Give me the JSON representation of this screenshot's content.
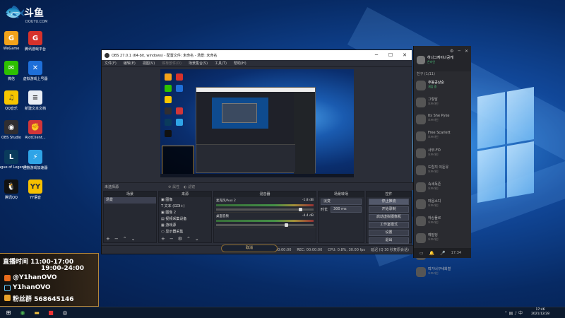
{
  "brand": {
    "title": "斗鱼",
    "subtitle": "DOUYU.COM",
    "room": "2"
  },
  "desktop_icons": [
    {
      "label": "WeGame",
      "icon": "wegame-icon",
      "color": "#f2a21a",
      "glyph": "G"
    },
    {
      "label": "腾讯游戏平台",
      "icon": "tencent-game-icon",
      "color": "#d7322b",
      "glyph": "G"
    },
    {
      "label": "微信",
      "icon": "wechat-icon",
      "color": "#2dc100",
      "glyph": "✉"
    },
    {
      "label": "虚拟游戏上号器",
      "icon": "account-tool-icon",
      "color": "#1e6fd9",
      "glyph": "✕"
    },
    {
      "label": "QQ音乐",
      "icon": "qq-music-icon",
      "color": "#f7c600",
      "glyph": "♫"
    },
    {
      "label": "新建文本文档",
      "icon": "text-doc-icon",
      "color": "#e9eef5",
      "glyph": "≡"
    },
    {
      "label": "OBS Studio",
      "icon": "obs-icon",
      "color": "#302e31",
      "glyph": "◉"
    },
    {
      "label": "RiotClient...",
      "icon": "riot-icon",
      "color": "#d13639",
      "glyph": "✊"
    },
    {
      "label": "League of Legends",
      "icon": "lol-icon",
      "color": "#0a3b5c",
      "glyph": "L"
    },
    {
      "label": "迅游游戏加速器",
      "icon": "accelerator-icon",
      "color": "#2fa4e7",
      "glyph": "⚡"
    },
    {
      "label": "腾讯QQ",
      "icon": "qq-icon",
      "color": "#111111",
      "glyph": "🐧"
    },
    {
      "label": "YY语音",
      "icon": "yy-icon",
      "color": "#f6c000",
      "glyph": "YY"
    }
  ],
  "obs": {
    "title": "OBS 27.0.1 (64-bit, windows) - 配置文件: 未命名 - 场景: 未命名",
    "menu": [
      "文件(F)",
      "编辑(E)",
      "视图(V)",
      "停靠部件(D)",
      "场景集合(S)",
      "工具(T)",
      "帮助(H)"
    ],
    "no_source": "未选择源",
    "props_label": "属性",
    "filter_label": "滤镜",
    "docks": {
      "scenes": "场景",
      "sources": "来源",
      "mixer": "混音器",
      "transitions": "场景转场",
      "controls": "控件"
    },
    "scenes": [
      "场景"
    ],
    "sources": [
      "图像",
      "文本 (GDI+)",
      "图像 2",
      "视频采集设备",
      "游戏源",
      "显示器采集"
    ],
    "mixer": [
      {
        "name": "麦克风/Aux 2",
        "db": "-1.8 dB",
        "level": 0.85
      },
      {
        "name": "桌面音频",
        "db": "-4.4 dB",
        "level": 0.7
      }
    ],
    "transition": {
      "type": "淡变",
      "duration_label": "时长",
      "duration": "300 ms"
    },
    "controls": [
      "停止推流",
      "开始录制",
      "启动虚拟摄像机",
      "工作室模式",
      "设置",
      "退出"
    ],
    "status": {
      "live_time": "LIVE: 00:00:00",
      "rec_time": "REC: 00:00:00",
      "cpu": "CPU: 0.8%, 30.00 fps",
      "drops": "延迟 (Q 30 秒复原会话)"
    },
    "bottom_button": "取消"
  },
  "kakao": {
    "title": "하나그케이너공케",
    "subtitle": "온라인",
    "section": "친구 (1/11)",
    "items": [
      {
        "name": "주동공상순",
        "status": "게임 중"
      },
      {
        "name": "그렇담",
        "status": "오프라인"
      },
      {
        "name": "Its She Pyke",
        "status": "오프라인"
      },
      {
        "name": "Free Scarlett",
        "status": "오프라인"
      },
      {
        "name": "사부-FO",
        "status": "오프라인"
      },
      {
        "name": "드립지 이둔유",
        "status": "오프라인"
      },
      {
        "name": "속세독존",
        "status": "오프라인"
      },
      {
        "name": "마음소디",
        "status": "오프라인"
      },
      {
        "name": "하상물르",
        "status": "오프라인"
      },
      {
        "name": "예빌딩",
        "status": "오프라인"
      },
      {
        "name": "전이 이어드리개",
        "status": "오프라인"
      },
      {
        "name": "띠가너구새희철",
        "status": "오프라인"
      }
    ],
    "footer_time": "17:34"
  },
  "overlay": {
    "schedule_label": "直播时间",
    "time1": "11:00-17:00",
    "time2": "19:00-24:00",
    "weibo": "@Y1hanOVO",
    "douyin": "Y1hanOVO",
    "fans_label": "粉丝群",
    "fans_group": "568645146"
  },
  "taskbar": {
    "time": "17:46",
    "date": "2021/12/28"
  }
}
